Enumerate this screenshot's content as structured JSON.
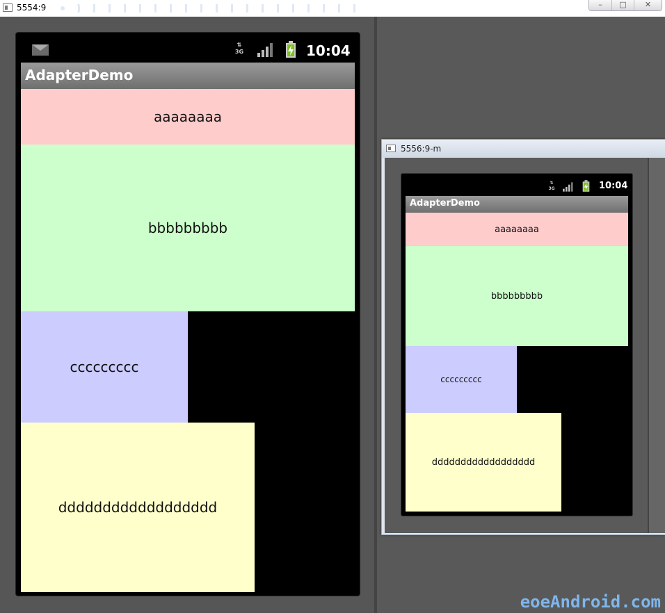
{
  "window_main": {
    "title": "5554:9",
    "controls": {
      "minimize": "–",
      "maximize": "□",
      "close": "✕"
    }
  },
  "window_secondary": {
    "title": "5556:9-m"
  },
  "phone_main": {
    "status_bar": {
      "network": "3G",
      "time": "10:04",
      "icons": [
        "mail-icon",
        "network-3g-icon",
        "signal-icon",
        "battery-charging-icon"
      ]
    },
    "app_title": "AdapterDemo",
    "items": [
      {
        "label": "aaaaaaaa",
        "color": "#ffcccc"
      },
      {
        "label": "bbbbbbbbb",
        "color": "#ccffcc"
      },
      {
        "label": "ccccccccc",
        "color": "#ccccff"
      },
      {
        "label": "dddddddddddddddddd",
        "color": "#ffffcc"
      }
    ]
  },
  "phone_secondary": {
    "status_bar": {
      "network": "3G",
      "time": "10:04",
      "icons": [
        "network-3g-icon",
        "signal-icon",
        "battery-charging-icon"
      ]
    },
    "app_title": "AdapterDemo",
    "items": [
      {
        "label": "aaaaaaaa",
        "color": "#ffcccc"
      },
      {
        "label": "bbbbbbbbb",
        "color": "#ccffcc"
      },
      {
        "label": "ccccccccc",
        "color": "#ccccff"
      },
      {
        "label": "dddddddddddddddddd",
        "color": "#ffffcc"
      }
    ]
  },
  "watermark": "eoeAndroid.com",
  "colors": {
    "emulator_bg": "#565656",
    "titlebar_gradient": [
      "#9a9a9a",
      "#6f6f6f"
    ],
    "watermark": "#7fb6ec"
  }
}
